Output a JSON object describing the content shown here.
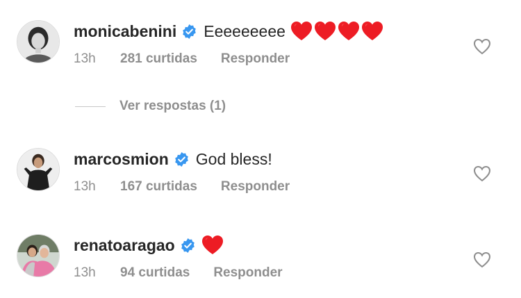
{
  "colors": {
    "text": "#262626",
    "muted": "#8e8e8e",
    "verified": "#3897f0",
    "heart": "#ed1c24"
  },
  "comments": [
    {
      "username": "monicabenini",
      "verified_icon": "verified-badge-icon",
      "text": "Eeeeeeeee",
      "emoji": [
        "red-heart",
        "red-heart",
        "red-heart",
        "red-heart"
      ],
      "time": "13h",
      "likes": "281 curtidas",
      "reply": "Responder"
    },
    {
      "username": "marcosmion",
      "verified_icon": "verified-badge-icon",
      "text": "God bless!",
      "emoji": [],
      "time": "13h",
      "likes": "167 curtidas",
      "reply": "Responder"
    },
    {
      "username": "renatoaragao",
      "verified_icon": "verified-badge-icon",
      "text": "",
      "emoji": [
        "red-heart"
      ],
      "time": "13h",
      "likes": "94 curtidas",
      "reply": "Responder"
    }
  ],
  "view_replies": "Ver respostas (1)",
  "like_icon": "heart-outline-icon"
}
